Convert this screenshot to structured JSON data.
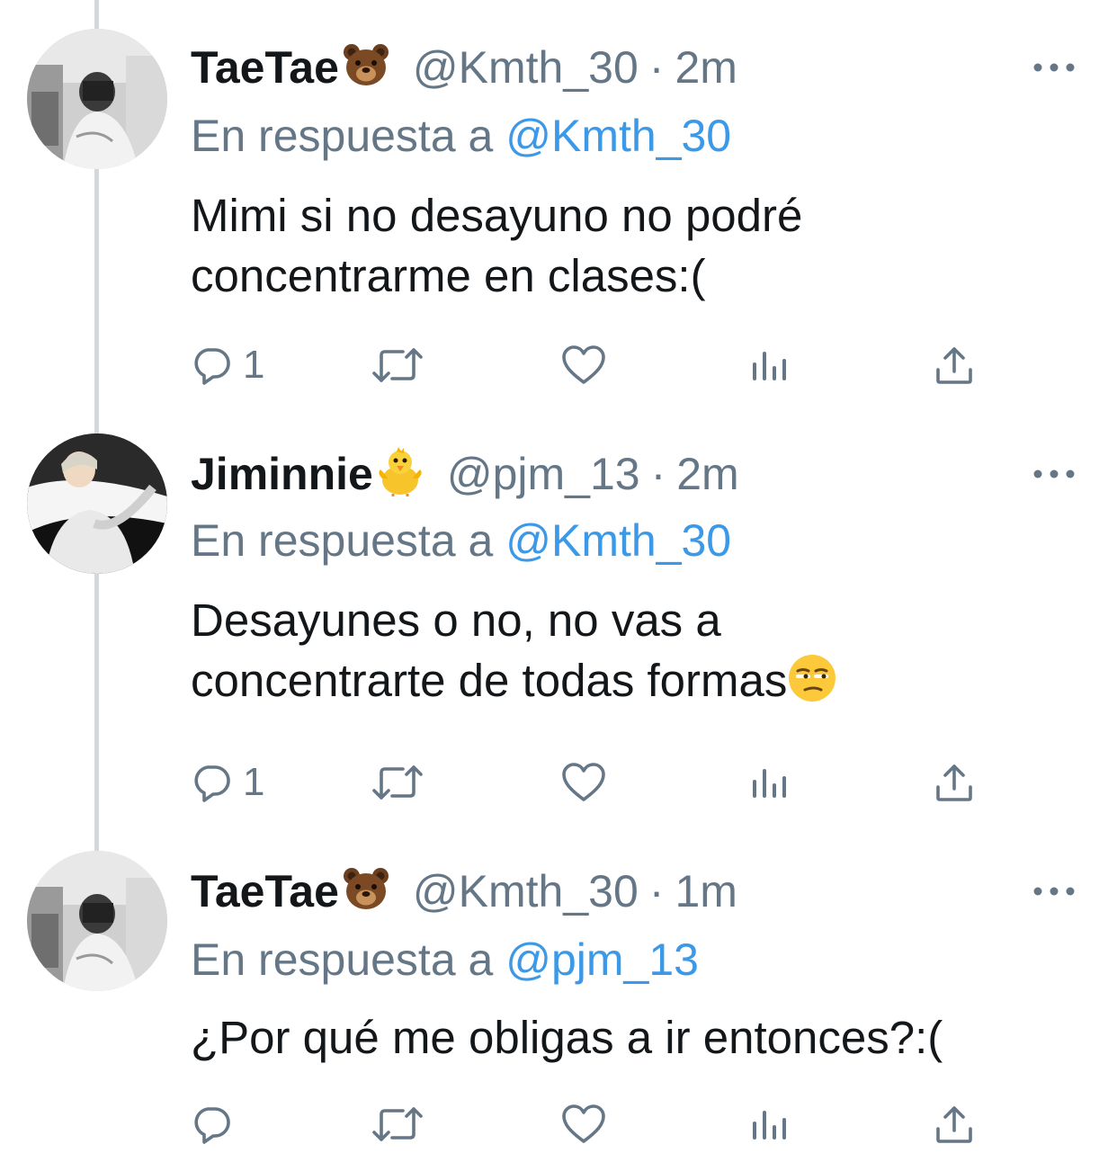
{
  "tweets": [
    {
      "name": "TaeTae",
      "name_emoji": "bear-face-emoji",
      "handle": "@Kmth_30",
      "separator": "·",
      "time": "2m",
      "reply_prefix": "En respuesta a",
      "reply_to": "@Kmth_30",
      "text": "Mimi si no desayuno no podré concentrarme en clases:(",
      "text_emoji": "",
      "reply_count": "1"
    },
    {
      "name": "Jiminnie",
      "name_emoji": "baby-chick-emoji",
      "handle": "@pjm_13",
      "separator": "·",
      "time": "2m",
      "reply_prefix": "En respuesta a",
      "reply_to": "@Kmth_30",
      "text": "Desayunes o no, no vas a concentrarte de todas formas",
      "text_emoji": "unamused-face-emoji",
      "reply_count": "1"
    },
    {
      "name": "TaeTae",
      "name_emoji": "bear-face-emoji",
      "handle": "@Kmth_30",
      "separator": "·",
      "time": "1m",
      "reply_prefix": "En respuesta a",
      "reply_to": "@pjm_13",
      "text": "¿Por qué me obligas a ir entonces?:(",
      "text_emoji": "",
      "reply_count": ""
    }
  ],
  "colors": {
    "text": "#14171a",
    "secondary": "#657786",
    "link": "#3b99e8",
    "thread_line": "#cfd9de"
  },
  "icons": [
    "reply-icon",
    "retweet-icon",
    "like-icon",
    "analytics-icon",
    "share-icon",
    "more-options-icon"
  ]
}
